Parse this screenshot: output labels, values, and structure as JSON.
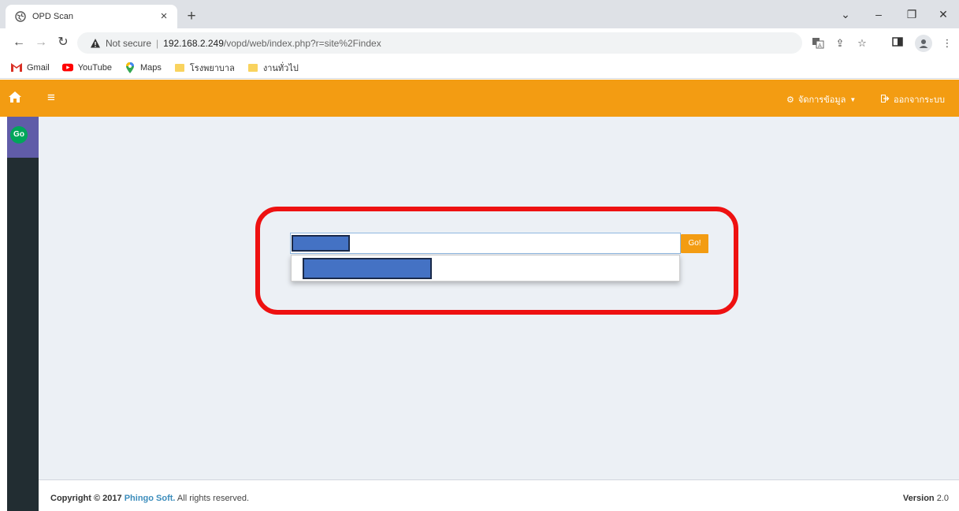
{
  "browser": {
    "tab_title": "OPD Scan",
    "tab_close": "×",
    "new_tab": "+",
    "address": {
      "security_label": "Not secure",
      "separator": "|",
      "host": "192.168.2.249",
      "path": "/vopd/web/index.php?r=site%2Findex"
    },
    "bookmarks": [
      {
        "label": "Gmail",
        "icon": "gmail-icon"
      },
      {
        "label": "YouTube",
        "icon": "youtube-icon"
      },
      {
        "label": "Maps",
        "icon": "maps-icon"
      },
      {
        "label": "โรงพยาบาล",
        "icon": "folder-icon"
      },
      {
        "label": "งานทั่วไป",
        "icon": "folder-icon"
      }
    ],
    "window_controls": [
      "⌄",
      "–",
      "❐",
      "✕"
    ]
  },
  "app": {
    "nav": {
      "menu_icon": "≡",
      "manage_label": "จัดการข้อมูล",
      "logout_label": "ออกจากระบบ"
    },
    "brand_logo": "Go",
    "search": {
      "go_label": "Go!"
    },
    "footer": {
      "copyright_prefix": "Copyright © 2017",
      "company": "Phingo Soft.",
      "rights": "All rights reserved.",
      "version_label": "Version",
      "version_number": "2.0"
    },
    "colors": {
      "nav": "#f39c12",
      "sidebar": "#222d32",
      "brand": "#605ca8",
      "highlight": "#ee1111",
      "redaction": "#4472c4"
    }
  }
}
